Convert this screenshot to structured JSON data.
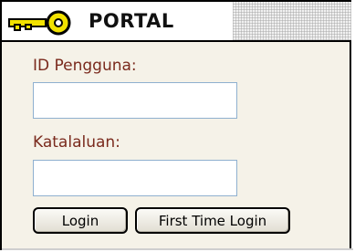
{
  "portal": {
    "title": "PORTAL",
    "icon": "key-icon"
  },
  "form": {
    "user_label": "ID Pengguna:",
    "user_value": "",
    "pass_label": "Katalaluan:",
    "pass_value": ""
  },
  "buttons": {
    "login_label": "Login",
    "first_time_label": "First Time Login"
  },
  "colors": {
    "label": "#7a2a1d",
    "key": "#f2e200",
    "panel_bg": "#f5f2e8",
    "field_border": "#8fb0cf"
  }
}
